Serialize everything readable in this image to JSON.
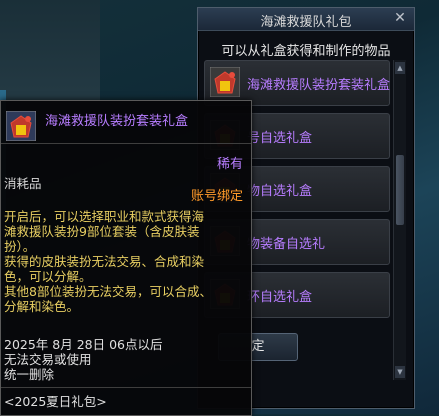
{
  "window": {
    "title": "海滩救援队礼包",
    "close_glyph": "✕",
    "subtitle": "可以从礼盒获得和制作的物品",
    "confirm_label": "确定",
    "visible_confirm_label": "定",
    "items": [
      {
        "label": "海滩救援队装扮套装礼盒",
        "visible_label": "海滩救援队装扮套装礼盒",
        "icon": "gift-box-icon"
      },
      {
        "label": "号自选礼盒",
        "visible_label": "号自选礼盒",
        "icon": "gift-box-icon"
      },
      {
        "label": "物自选礼盒",
        "visible_label": "物自选礼盒",
        "icon": "gift-box-icon"
      },
      {
        "label": "物装备自选礼",
        "visible_label": "物装备自选礼",
        "icon": "gift-box-icon"
      },
      {
        "label": "环自选礼盒",
        "visible_label": "环自选礼盒",
        "icon": "gift-box-icon"
      }
    ],
    "scroll_up_glyph": "▲",
    "scroll_down_glyph": "▼"
  },
  "tooltip": {
    "name": "海滩救援队装扮套装礼盒",
    "rarity": "稀有",
    "category": "消耗品",
    "bind": "账号绑定",
    "desc_lines": [
      "开启后，可以选择职业和款式获得海",
      "滩救援队装扮9部位套装（含皮肤装",
      "扮）。",
      "获得的皮肤装扮无法交易、合成和染",
      "色，可以分解。",
      "其他8部位装扮无法交易，可以合成、",
      "分解和染色。"
    ],
    "expire_lines": [
      "2025年 8月 28日 06点以后",
      "无法交易或使用",
      "统一删除"
    ],
    "source": "<2025夏日礼包>"
  },
  "colors": {
    "rare_purple": "#b77dff",
    "bind_orange": "#ff9a2a",
    "desc_yellow": "#e8cf62"
  }
}
